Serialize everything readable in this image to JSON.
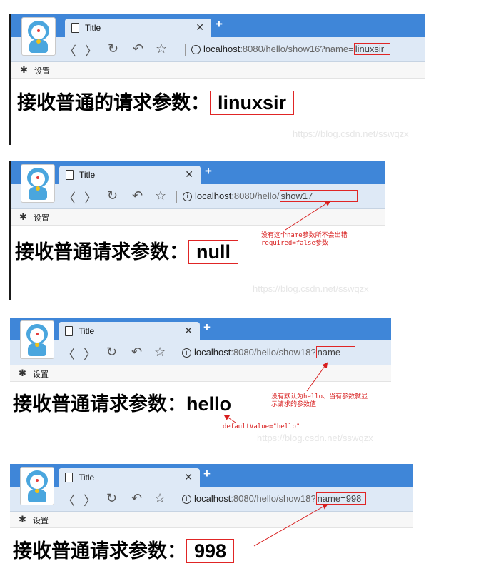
{
  "tab": {
    "title": "Title"
  },
  "bookmark": {
    "label": "设置"
  },
  "panels": [
    {
      "host": "localhost",
      "path": ":8080/hello/show16?name=",
      "highlight": "linuxsir",
      "heading": "接收普通的请求参数：",
      "value": "linuxsir"
    },
    {
      "host": "localhost",
      "path": ":8080/hello/",
      "highlight": "show17",
      "heading": "接收普通请求参数：",
      "value": "null"
    },
    {
      "host": "localhost",
      "path": ":8080/hello/show18?",
      "highlight": "name",
      "heading": "接收普通请求参数：",
      "value": "hello"
    },
    {
      "host": "localhost",
      "path": ":8080/hello/show18?",
      "highlight": "name=998",
      "heading": "接收普通请求参数：",
      "value": "998"
    }
  ],
  "annotations": {
    "p2_line1": "没有这个name参数所不会出错",
    "p2_line2": "required=false参数",
    "p3_line1": "没有默认为hello、当有参数就显",
    "p3_line2": "示请求的参数值",
    "p3_default": "defaultValue=\"hello\""
  },
  "watermark": "https://blog.csdn.net/sswqzx",
  "colors": {
    "titlebar": "#3f86d8",
    "toolbar": "#dee9f6",
    "annotation": "#d81e1e"
  }
}
